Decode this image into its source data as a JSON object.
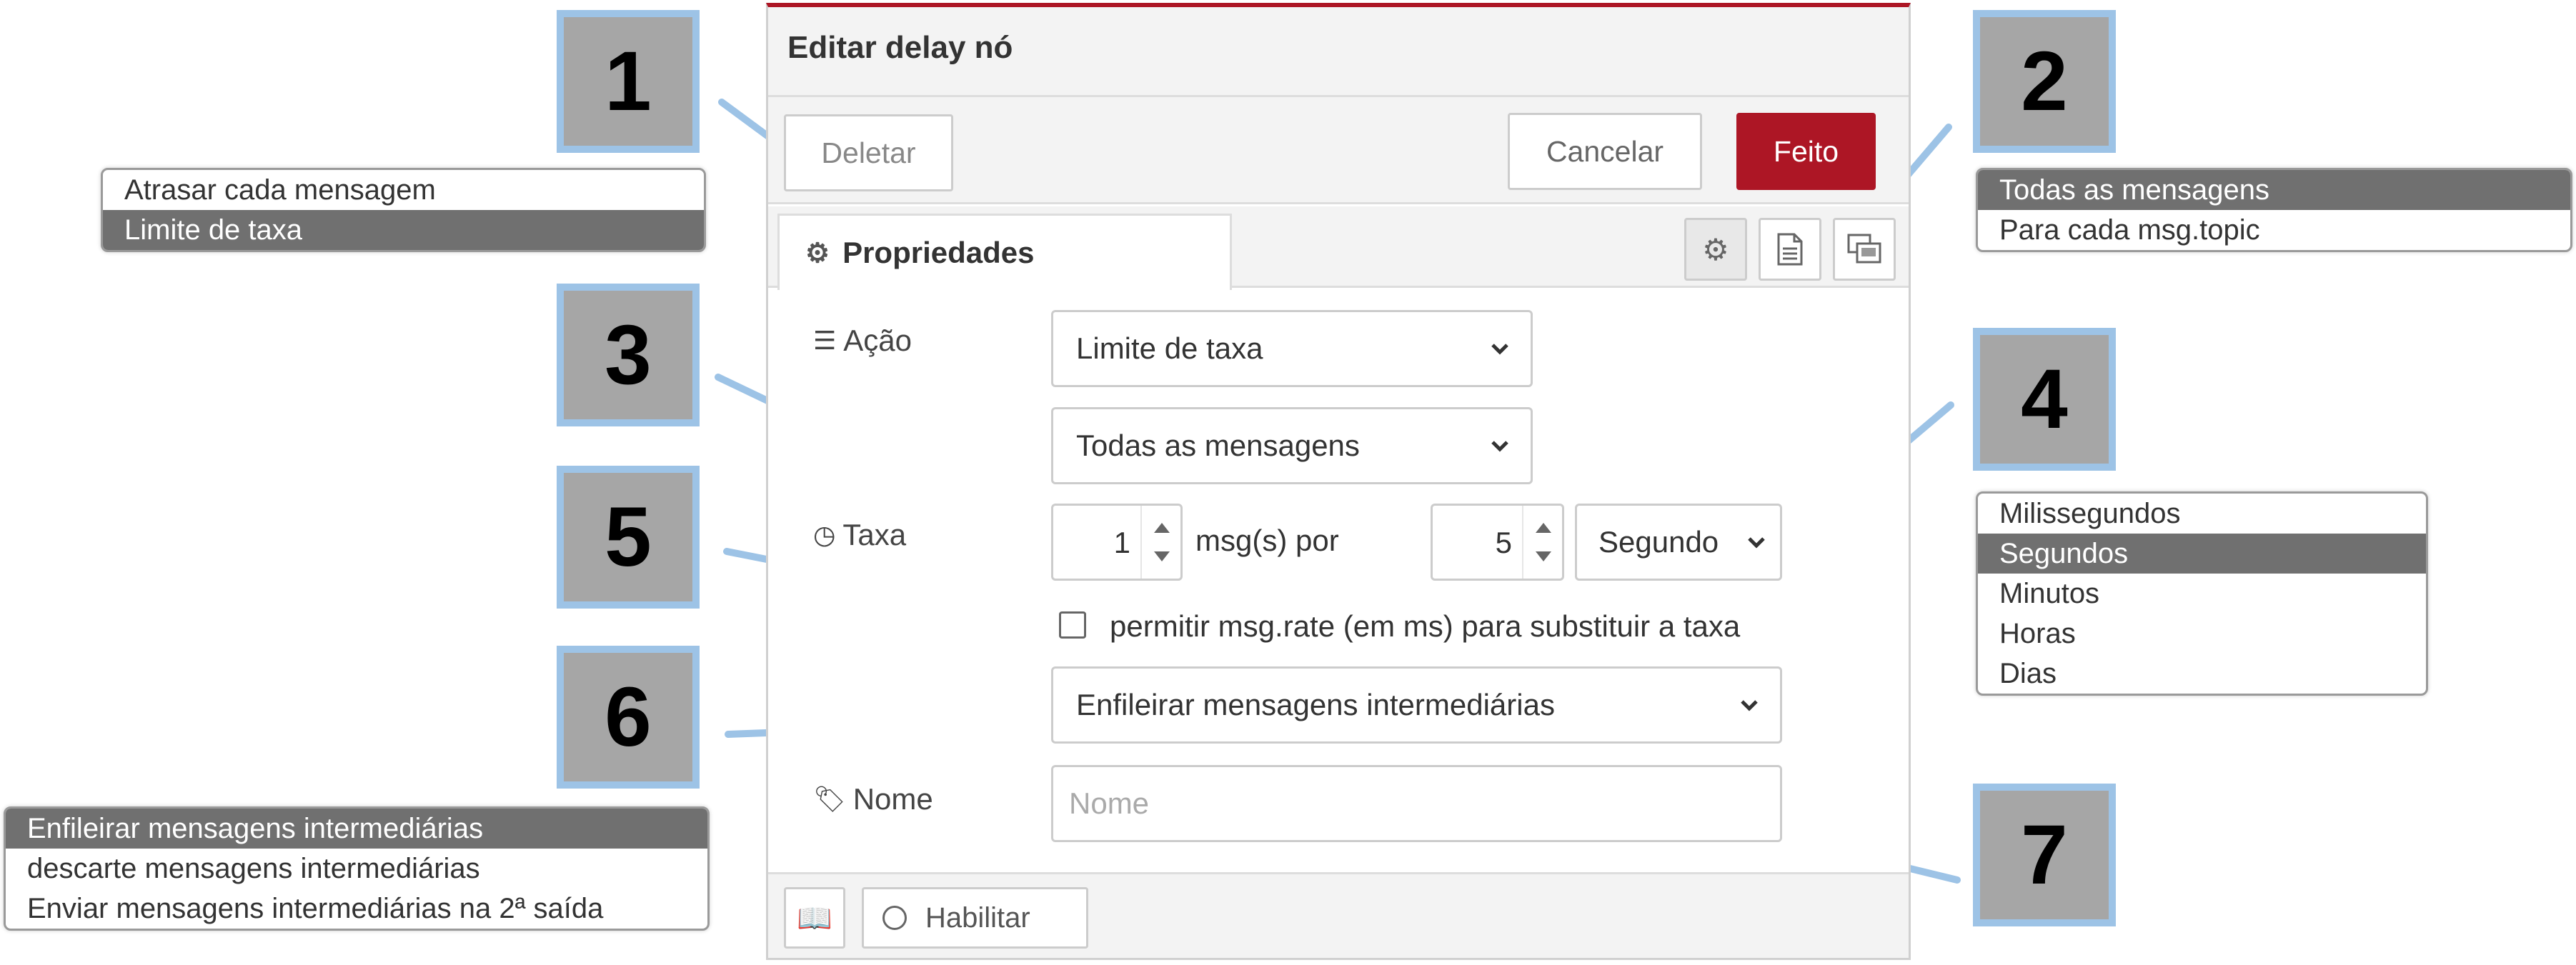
{
  "dialog": {
    "title": "Editar delay nó",
    "buttons": {
      "delete": "Deletar",
      "cancel": "Cancelar",
      "done": "Feito"
    },
    "tab": {
      "label": "Propriedades"
    },
    "fields": {
      "action": {
        "label": "Ação",
        "value": "Limite de taxa"
      },
      "scope": {
        "value": "Todas as mensagens"
      },
      "rate": {
        "label": "Taxa",
        "count": "1",
        "per_text": "msg(s) por",
        "interval": "5",
        "unit": "Segundo"
      },
      "override": {
        "checked": false,
        "label": "permitir msg.rate (em ms) para substituir a taxa"
      },
      "drop": {
        "value": "Enfileirar mensagens intermediárias"
      },
      "name": {
        "label": "Nome",
        "placeholder": "Nome",
        "value": ""
      }
    },
    "footer": {
      "enable_label": "Habilitar"
    },
    "colors": {
      "accent": "#ad1625",
      "callout_fill": "#a6a6a6",
      "callout_border": "#9dc3e6",
      "selected_option": "#707070"
    }
  },
  "callouts": [
    "1",
    "2",
    "3",
    "4",
    "5",
    "6",
    "7"
  ],
  "option_lists": {
    "action": {
      "options": [
        "Atrasar cada mensagem",
        "Limite de taxa"
      ],
      "selected": 1
    },
    "scope": {
      "options": [
        "Todas as mensagens",
        "Para cada msg.topic"
      ],
      "selected": 0
    },
    "units": {
      "options": [
        "Milissegundos",
        "Segundos",
        "Minutos",
        "Horas",
        "Dias"
      ],
      "selected": 1
    },
    "drop": {
      "options": [
        "Enfileirar mensagens intermediárias",
        "descarte mensagens intermediárias",
        "Enviar mensagens intermediárias na 2ª saída"
      ],
      "selected": 0
    }
  },
  "icons": [
    "gear-icon",
    "document-icon",
    "window-icon",
    "list-icon",
    "clock-icon",
    "tag-icon",
    "book-icon",
    "chevron-down-icon"
  ]
}
